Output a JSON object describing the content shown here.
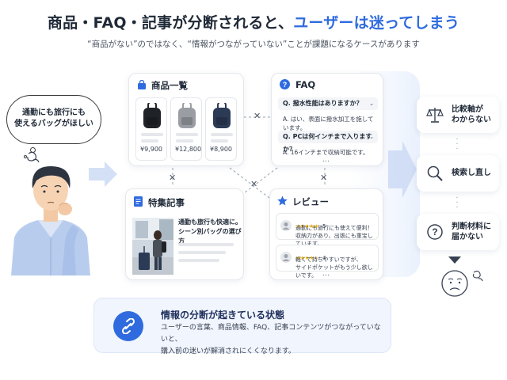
{
  "header": {
    "title_prefix": "商品・FAQ・記事が分断されると、",
    "title_accent": "ユーザーは迷ってしまう",
    "subtitle": "“商品がない”のではなく、“情報がつながっていない”ことが課題になるケースがあります"
  },
  "user": {
    "speech": [
      "通勤にも旅行にも",
      "使えるバッグがほしい"
    ]
  },
  "products": {
    "title": "商品一覧",
    "items": [
      {
        "price": "¥9,900",
        "color": "#1f2226"
      },
      {
        "price": "¥12,800",
        "color": "#9a9ea4"
      },
      {
        "price": "¥8,900",
        "color": "#2b3a55"
      }
    ]
  },
  "faq": {
    "title": "FAQ",
    "items": [
      {
        "q": "Q. 撥水性能はありますか？",
        "a": "A. はい、表面に撥水加工を施しています。"
      },
      {
        "q": "Q. PCは何インチまで入りますか？",
        "a": "A. 16インチまで収納可能です。"
      }
    ],
    "more": "…"
  },
  "article": {
    "title": "特集記事",
    "headline": [
      "通勤も旅行も快適に。",
      "シーン別バッグの選び方"
    ]
  },
  "reviews": {
    "title": "レビュー",
    "items": [
      {
        "stars": "★★★★★",
        "rating": "5",
        "text": [
          "通勤にも旅行にも使えて便利！",
          "収納力があり、出張にも重宝しています。"
        ]
      },
      {
        "stars": "★★★★☆",
        "rating": "4",
        "text": [
          "軽くて持ちやすいですが、",
          "サイドポケットがもう少し欲しいです。"
        ]
      }
    ],
    "more": "…"
  },
  "issues": [
    {
      "icon": "scale-icon",
      "label": [
        "比較軸が",
        "わからない"
      ]
    },
    {
      "icon": "search-icon",
      "label": [
        "検索し直し"
      ]
    },
    {
      "icon": "question-icon",
      "label": [
        "判断材料に",
        "届かない"
      ]
    }
  ],
  "info": {
    "title": "情報の分断が起きている状態",
    "body": [
      "ユーザーの言葉、商品情報、FAQ、記事コンテンツがつながっていないと、",
      "購入前の迷いが解消されにくくなります。"
    ]
  },
  "colors": {
    "accent": "#2f6bdf",
    "star": "#f5b301"
  }
}
